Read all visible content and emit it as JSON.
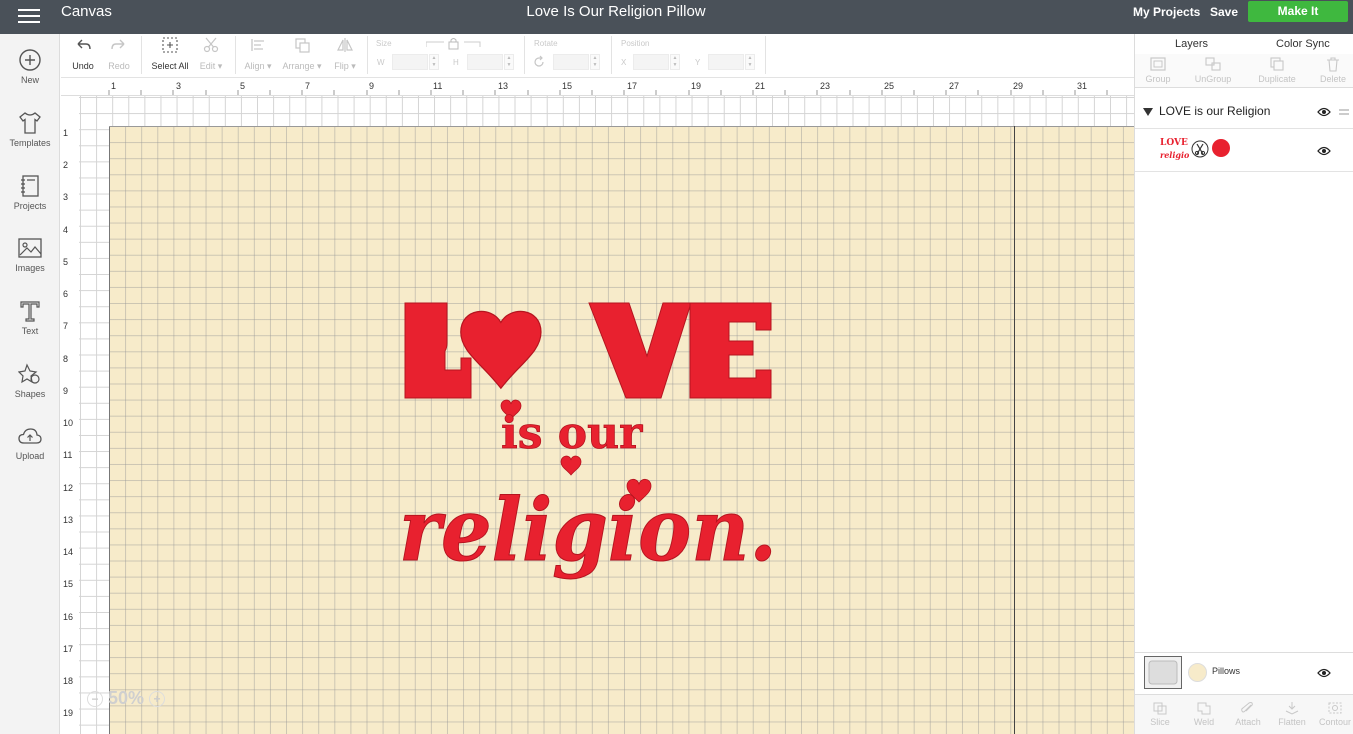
{
  "topbar": {
    "app_title": "Canvas",
    "doc_title": "Love Is Our Religion Pillow",
    "my_projects": "My Projects",
    "save": "Save",
    "make_it": "Make It"
  },
  "leftnav": {
    "new": "New",
    "templates": "Templates",
    "projects": "Projects",
    "images": "Images",
    "text": "Text",
    "shapes": "Shapes",
    "upload": "Upload"
  },
  "toolbar": {
    "undo": "Undo",
    "redo": "Redo",
    "select_all": "Select All",
    "edit": "Edit",
    "align": "Align",
    "arrange": "Arrange",
    "flip": "Flip",
    "size": "Size",
    "w": "W",
    "h": "H",
    "rotate": "Rotate",
    "position": "Position",
    "x": "X",
    "y": "Y"
  },
  "rulers": {
    "top": [
      "1",
      "3",
      "5",
      "7",
      "9",
      "11",
      "13",
      "15",
      "17",
      "19",
      "21",
      "23",
      "25",
      "27",
      "29",
      "31"
    ],
    "left": [
      "1",
      "2",
      "3",
      "4",
      "5",
      "6",
      "7",
      "8",
      "9",
      "10",
      "11",
      "12",
      "13",
      "14",
      "15",
      "16",
      "17",
      "18",
      "19"
    ]
  },
  "canvas": {
    "zoom": "50%",
    "mat_color": "#f7ebca",
    "design_color": "#e8212f",
    "design_words": {
      "love": "LOVE",
      "middle": "is our",
      "bottom": "religion."
    }
  },
  "layers_panel": {
    "tab_layers": "Layers",
    "tab_color_sync": "Color Sync",
    "actions": {
      "group": "Group",
      "ungroup": "UnGroup",
      "duplicate": "Duplicate",
      "delete": "Delete"
    },
    "group_name": "LOVE is our Religion",
    "thumb_text": "LOVE is our religion.",
    "pillow_label": "Pillows",
    "bottom_actions": {
      "slice": "Slice",
      "weld": "Weld",
      "attach": "Attach",
      "flatten": "Flatten",
      "contour": "Contour"
    }
  }
}
